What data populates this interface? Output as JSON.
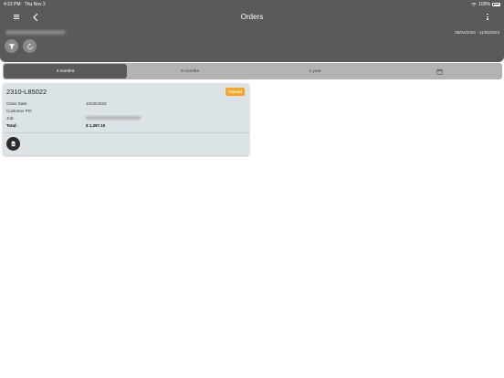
{
  "status_bar": {
    "time": "4:22 PM",
    "date": "Thu Nov 2",
    "battery": "100%"
  },
  "header": {
    "title": "Orders",
    "date_range": "08/04/2023 - 11/02/2023"
  },
  "tabs": [
    {
      "label": "3 months",
      "active": true
    },
    {
      "label": "6 months",
      "active": false
    },
    {
      "label": "1 year",
      "active": false
    }
  ],
  "orders": [
    {
      "order_number": "2310-L85022",
      "status": "Closed",
      "order_date_label": "Order Date:",
      "order_date": "10/20/2023",
      "customer_po_label": "Customer PO:",
      "customer_po": "",
      "job_label": "Job:",
      "total_label": "Total:",
      "total": "$ 1,397.10"
    }
  ],
  "colors": {
    "header_bg": "#5a5a5a",
    "status_closed": "#f5a623",
    "card_bg": "#dce3e6"
  }
}
